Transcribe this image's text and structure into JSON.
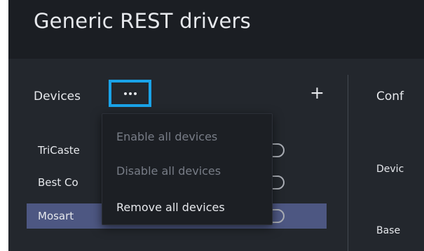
{
  "header": {
    "title": "Generic REST drivers"
  },
  "devices": {
    "title": "Devices",
    "more_icon": "ellipsis-icon",
    "add_label": "+",
    "items": [
      {
        "label": "TriCaste",
        "selected": false
      },
      {
        "label": "Best Co",
        "selected": false
      },
      {
        "label": "Mosart",
        "selected": true
      }
    ]
  },
  "config": {
    "title": "Conf",
    "labels": [
      "Devic",
      "Base"
    ]
  },
  "menu": {
    "items": [
      {
        "label": "Enable all devices",
        "enabled": false
      },
      {
        "label": "Disable all devices",
        "enabled": false
      },
      {
        "label": "Remove all devices",
        "enabled": true
      }
    ]
  },
  "colors": {
    "app_background": "#23272d",
    "header_background": "#1b1e23",
    "accent_focus": "#1aa3e8",
    "selected_row": "#4d5782",
    "menu_background": "#1c1f24"
  }
}
